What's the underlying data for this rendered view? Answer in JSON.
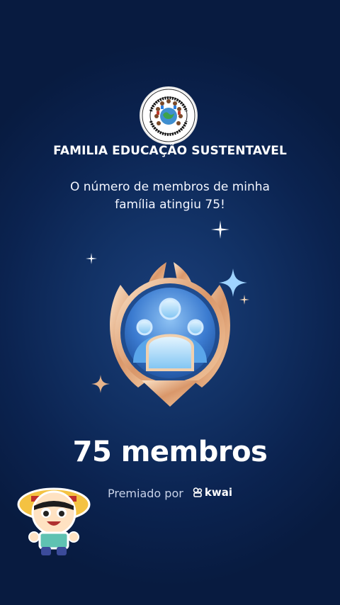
{
  "family": {
    "logo_icon": "family-logo-icon",
    "name": "FAMILIA EDUCAÇÃO SUSTENTAVEL"
  },
  "milestone": {
    "message_line1": "O número de membros de minha",
    "message_line2": "família atingiu 75!"
  },
  "badge": {
    "icon": "family-members-badge-icon",
    "count_label": "75 membros"
  },
  "award": {
    "prefix": "Premiado por",
    "brand": "kwai",
    "brand_icon": "kwai-logo-icon"
  },
  "sticker": {
    "icon": "anime-character-sticker-icon"
  },
  "colors": {
    "background": "#0b2350",
    "text": "#ffffff",
    "badge_gold": "#e8b48a",
    "badge_blue": "#4f8fdc"
  }
}
